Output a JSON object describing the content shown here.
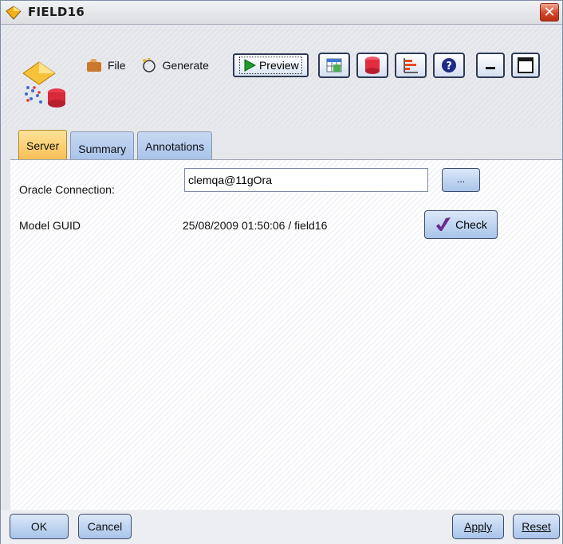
{
  "window": {
    "title": "FIELD16",
    "close_glyph": "✕"
  },
  "toolbar": {
    "file_label": "File",
    "generate_label": "Generate",
    "preview_label": "Preview",
    "icons": [
      "table-icon",
      "database-icon",
      "chart-icon",
      "help-icon"
    ],
    "window_icons": [
      "minimize-icon",
      "maximize-icon"
    ]
  },
  "tabs": [
    {
      "label": "Server",
      "active": true
    },
    {
      "label": "Summary",
      "active": false
    },
    {
      "label": "Annotations",
      "active": false
    }
  ],
  "server": {
    "connection_label": "Oracle Connection:",
    "connection_value": "clemqa@11gOra",
    "browse_label": "...",
    "guid_label": "Model GUID",
    "guid_value": "25/08/2009 01:50:06 / field16",
    "check_label": "Check"
  },
  "buttons": {
    "ok": "OK",
    "cancel": "Cancel",
    "apply": "Apply",
    "reset": "Reset"
  },
  "colors": {
    "active_tab": "#f7bf54",
    "inactive_tab": "#a9c3ea",
    "close_button": "#d1462a"
  }
}
